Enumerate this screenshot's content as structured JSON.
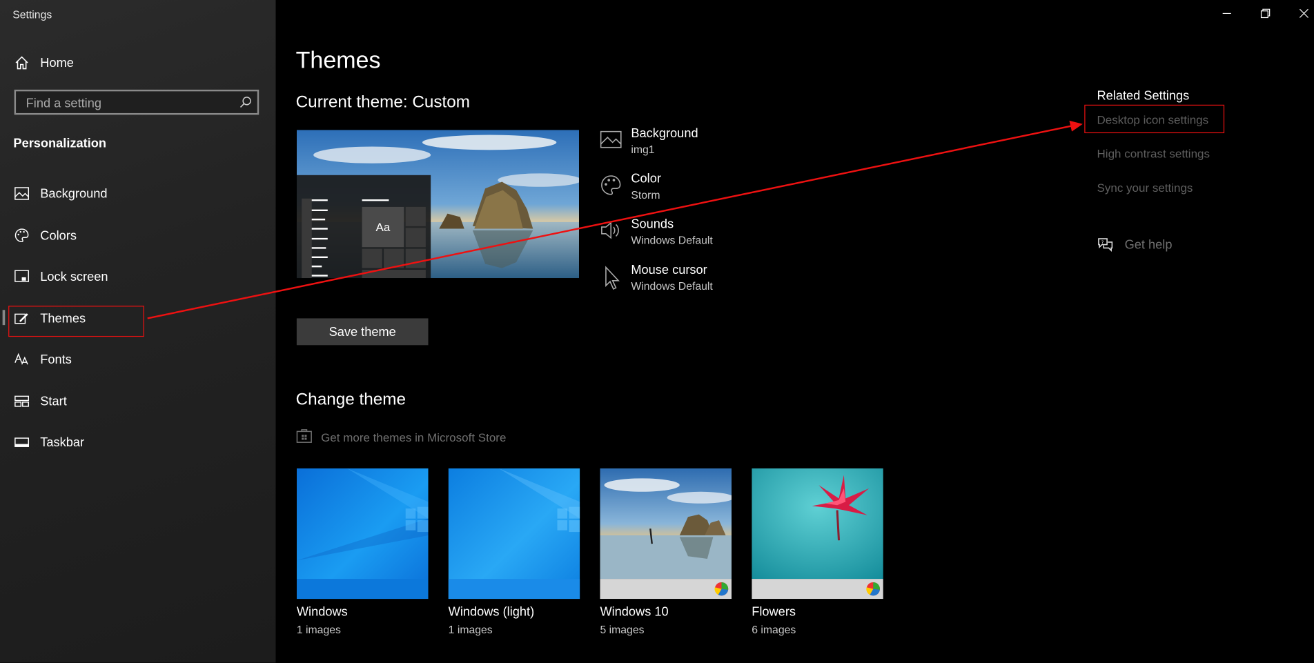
{
  "window": {
    "title": "Settings"
  },
  "sidebar": {
    "home_label": "Home",
    "search": {
      "placeholder": "Find a setting"
    },
    "section": "Personalization",
    "items": [
      {
        "label": "Background",
        "icon": "image-icon"
      },
      {
        "label": "Colors",
        "icon": "palette-icon"
      },
      {
        "label": "Lock screen",
        "icon": "lock-screen-icon"
      },
      {
        "label": "Themes",
        "icon": "themes-icon",
        "selected": true
      },
      {
        "label": "Fonts",
        "icon": "fonts-icon"
      },
      {
        "label": "Start",
        "icon": "start-icon"
      },
      {
        "label": "Taskbar",
        "icon": "taskbar-icon"
      }
    ]
  },
  "main": {
    "title": "Themes",
    "current_theme": "Current theme: Custom",
    "preview": {
      "tile_label": "Aa"
    },
    "properties": [
      {
        "name": "Background",
        "value": "img1",
        "icon": "image-icon"
      },
      {
        "name": "Color",
        "value": "Storm",
        "icon": "palette-icon"
      },
      {
        "name": "Sounds",
        "value": "Windows Default",
        "icon": "speaker-icon"
      },
      {
        "name": "Mouse cursor",
        "value": "Windows Default",
        "icon": "cursor-icon"
      }
    ],
    "save_button": "Save theme",
    "change_theme_title": "Change theme",
    "store_link": "Get more themes in Microsoft Store",
    "themes": [
      {
        "name": "Windows",
        "count": "1 images"
      },
      {
        "name": "Windows (light)",
        "count": "1 images"
      },
      {
        "name": "Windows 10",
        "count": "5 images"
      },
      {
        "name": "Flowers",
        "count": "6 images"
      }
    ]
  },
  "related": {
    "heading": "Related Settings",
    "links": [
      "Desktop icon settings",
      "High contrast settings",
      "Sync your settings"
    ],
    "help": "Get help"
  },
  "colors": {
    "accent_annotation": "#e11111",
    "background": "#000000",
    "sidebar": "#262626"
  }
}
